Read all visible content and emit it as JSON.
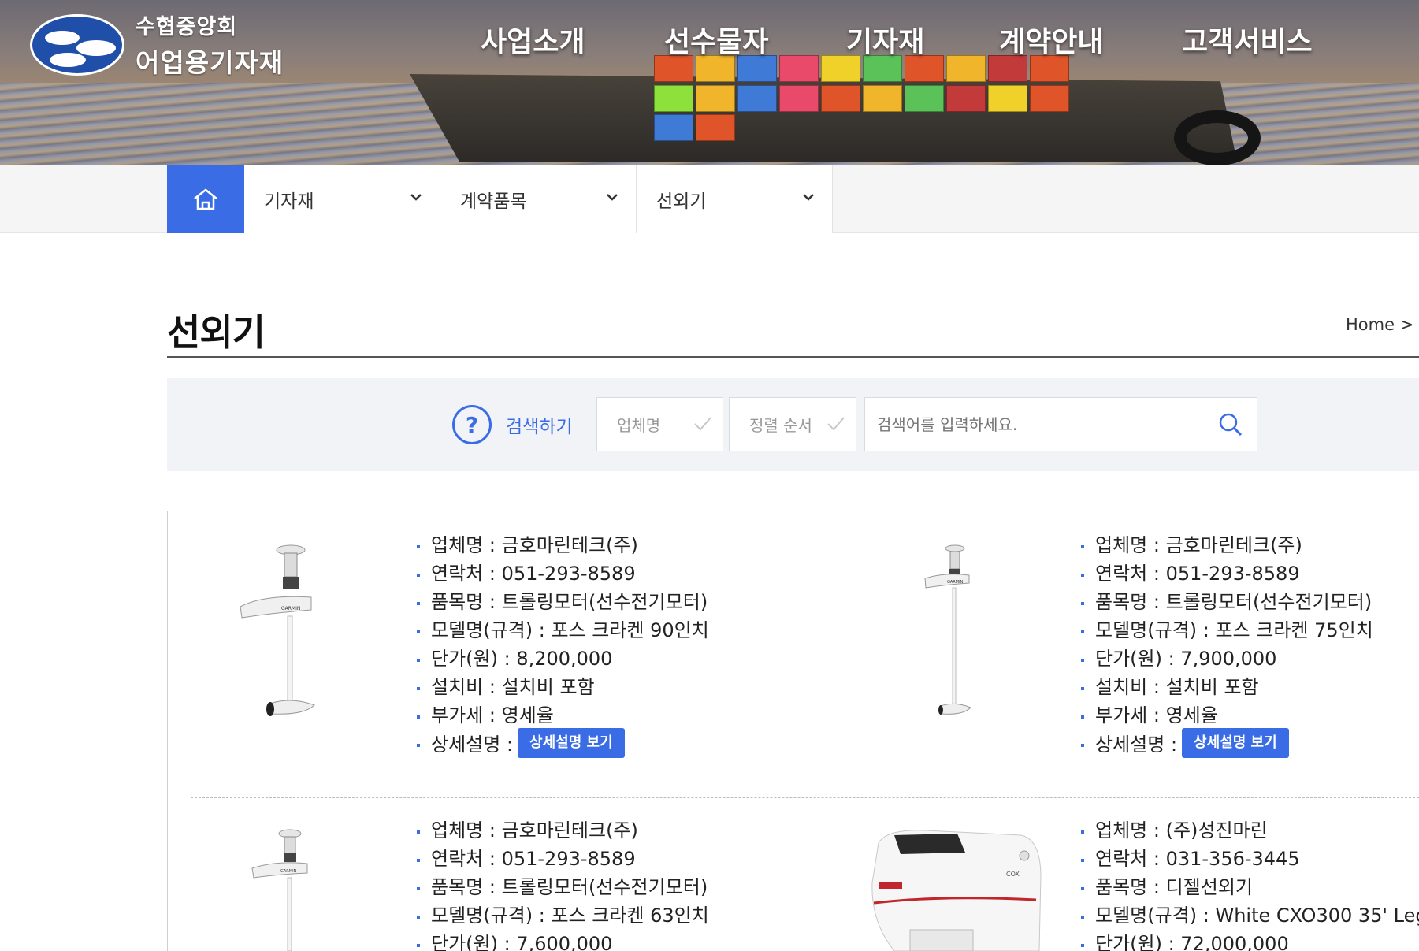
{
  "header": {
    "logo_line1": "수협중앙회",
    "logo_line2": "어업용기자재",
    "menu": [
      "사업소개",
      "선수물자",
      "기자재",
      "계약안내",
      "고객서비스"
    ]
  },
  "subnav": {
    "home_icon": "home-icon",
    "crumbs": [
      "기자재",
      "계약품목",
      "선외기"
    ]
  },
  "page": {
    "title": "선외기",
    "breadcrumb": "Home"
  },
  "search": {
    "help_glyph": "?",
    "label": "검색하기",
    "company_select": "업체명",
    "sort_select": "정렬 순서",
    "placeholder": "검색어를 입력하세요."
  },
  "colors": {
    "accent": "#3a6de5",
    "title_line": "#555555",
    "search_bg": "#f2f3f7"
  },
  "products": [
    {
      "company": "업체명 : 금호마린테크(주)",
      "contact": "연락처 : 051-293-8589",
      "item": "품목명 : 트롤링모터(선수전기모터)",
      "model": "모델명(규격) : 포스 크라켄 90인치",
      "price": "단가(원) : 8,200,000",
      "install": "설치비 : 설치비 포함",
      "vat": "부가세 : 영세율",
      "detail_label": "상세설명 :",
      "detail_button": "상세설명 보기",
      "image_text": "GARMIN"
    },
    {
      "company": "업체명 : 금호마린테크(주)",
      "contact": "연락처 : 051-293-8589",
      "item": "품목명 : 트롤링모터(선수전기모터)",
      "model": "모델명(규격) : 포스 크라켄 75인치",
      "price": "단가(원) : 7,900,000",
      "install": "설치비 : 설치비 포함",
      "vat": "부가세 : 영세율",
      "detail_label": "상세설명 :",
      "detail_button": "상세설명 보기",
      "image_text": "GARMIN"
    },
    {
      "company": "업체명 : 금호마린테크(주)",
      "contact": "연락처 : 051-293-8589",
      "item": "품목명 : 트롤링모터(선수전기모터)",
      "model": "모델명(규격) : 포스 크라켄 63인치",
      "price": "단가(원) : 7,600,000",
      "image_text": "GARMIN"
    },
    {
      "company": "업체명 : (주)성진마린",
      "contact": "연락처 : 031-356-3445",
      "item": "품목명 : 디젤선외기",
      "model": "모델명(규격) : White CXO300 35' Leg",
      "price": "단가(원) : 72,000,000",
      "image_text": "COX"
    }
  ]
}
